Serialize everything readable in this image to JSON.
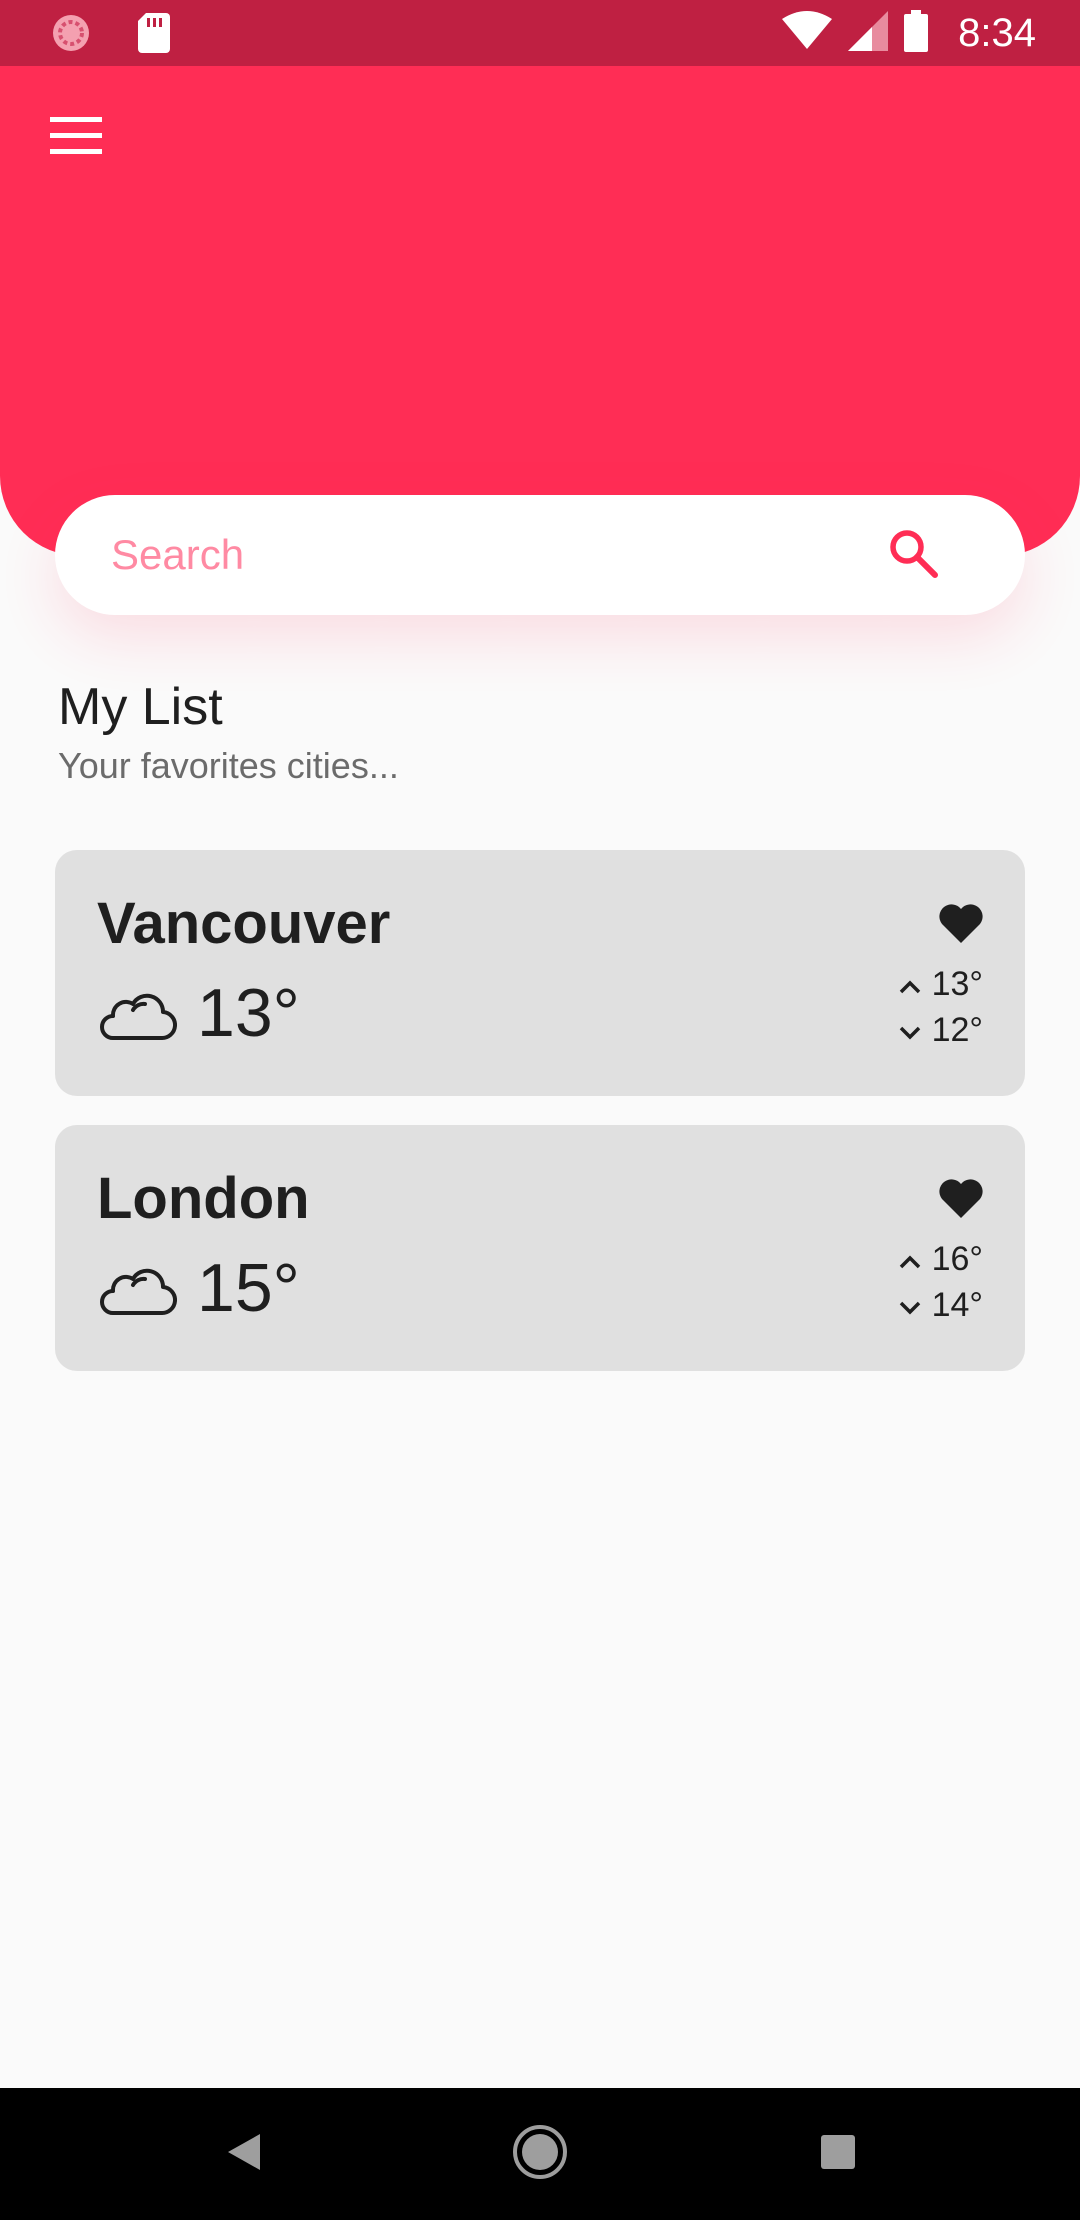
{
  "status_bar": {
    "time": "8:34"
  },
  "header": {
    "color": "#ff2d55"
  },
  "search": {
    "placeholder": "Search"
  },
  "list": {
    "title": "My List",
    "subtitle": "Your favorites cities..."
  },
  "cities": [
    {
      "name": "Vancouver",
      "temp": "13°",
      "high": "13°",
      "low": "12°",
      "condition_icon": "cloud-icon",
      "favorite": true
    },
    {
      "name": "London",
      "temp": "15°",
      "high": "16°",
      "low": "14°",
      "condition_icon": "cloud-icon",
      "favorite": true
    }
  ],
  "colors": {
    "accent": "#ff2d55",
    "status_bar": "#bf2042",
    "card_bg": "#e0e0e0",
    "page_bg": "#fafafa"
  }
}
